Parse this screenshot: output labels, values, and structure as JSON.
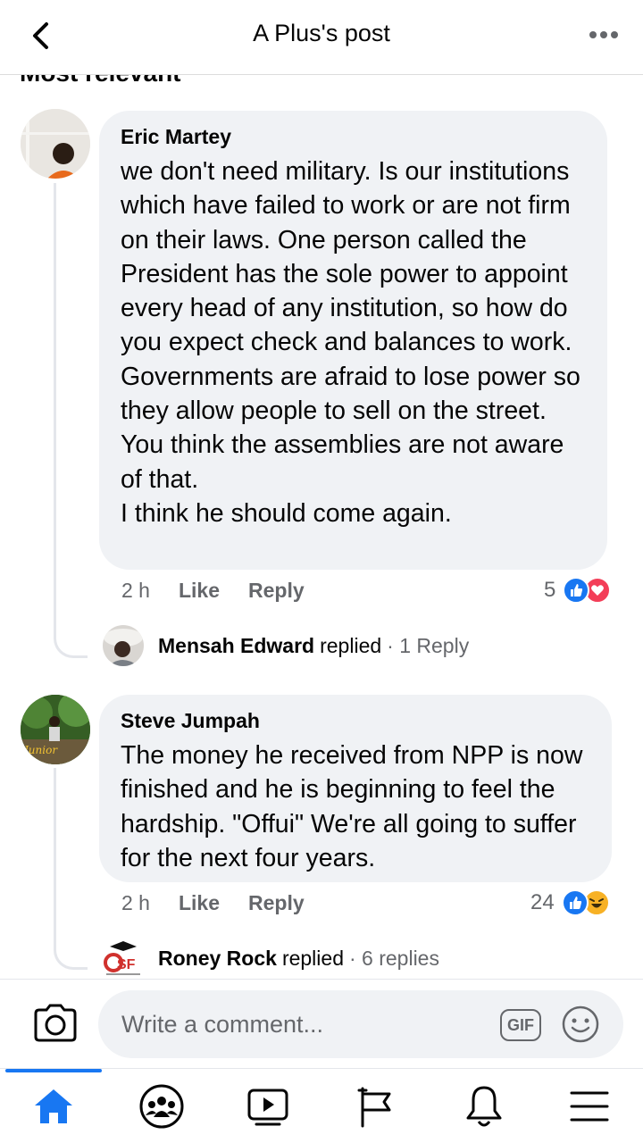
{
  "header": {
    "title": "A Plus's post",
    "back_icon": "chevron-left-icon",
    "more_icon": "more-horizontal-icon"
  },
  "section_heading": "Most relevant",
  "comments": [
    {
      "author": "Eric Martey",
      "text": "we don't need military. Is our institutions which have failed to work or are not firm on their laws. One person called the President has the sole power to appoint every head of any institution, so how do you expect check and balances to work. Governments are afraid to lose power so they allow people to sell on the street. You think the assemblies are not aware of that.\nI think he should come again.",
      "time": "2 h",
      "like_label": "Like",
      "reply_label": "Reply",
      "reaction_count": "5",
      "reactions": [
        "like",
        "love"
      ],
      "reply_preview": {
        "name": "Mensah Edward",
        "replied": "replied",
        "count": "· 1 Reply"
      }
    },
    {
      "author": "Steve Jumpah",
      "text": "The  money he received from NPP is now finished and he is beginning to feel the hardship. \"Offui\" We're all going to suffer for the next four years.",
      "time": "2 h",
      "like_label": "Like",
      "reply_label": "Reply",
      "reaction_count": "24",
      "reactions": [
        "like",
        "haha"
      ],
      "reply_preview": {
        "name": "Roney Rock",
        "replied": "replied",
        "count": "· 6 replies"
      }
    }
  ],
  "composer": {
    "placeholder": "Write a comment...",
    "gif_label": "GIF"
  },
  "bottom_nav": [
    {
      "name": "home",
      "icon": "home-icon",
      "active": true
    },
    {
      "name": "groups",
      "icon": "groups-icon",
      "active": false
    },
    {
      "name": "watch",
      "icon": "video-icon",
      "active": false
    },
    {
      "name": "pages",
      "icon": "flag-icon",
      "active": false
    },
    {
      "name": "notifications",
      "icon": "bell-icon",
      "active": false
    },
    {
      "name": "menu",
      "icon": "menu-icon",
      "active": false
    }
  ],
  "colors": {
    "accent": "#1877f2",
    "bubble": "#f0f2f5",
    "secondary_text": "#65676b",
    "love": "#f33e58",
    "haha": "#f7b125"
  }
}
